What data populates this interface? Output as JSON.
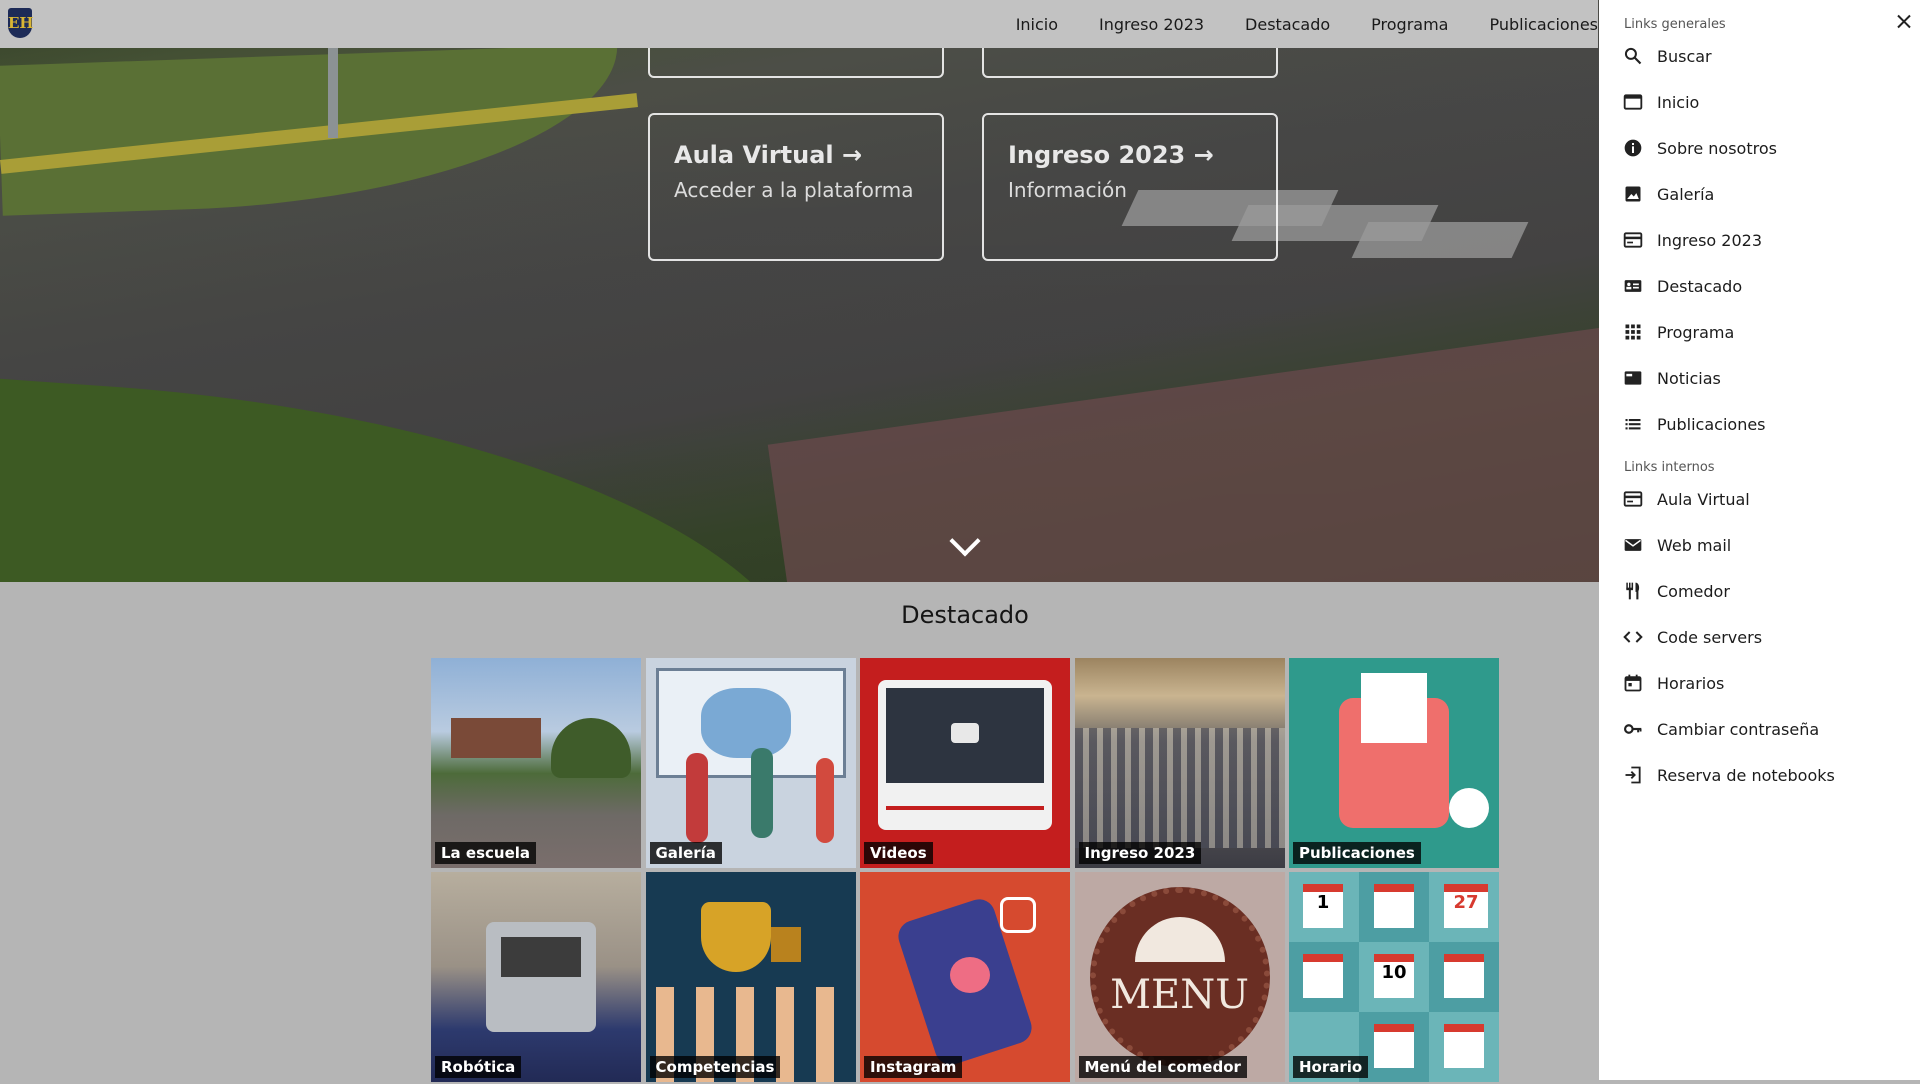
{
  "header": {
    "logo_text": "EH",
    "nav": [
      "Inicio",
      "Ingreso 2023",
      "Destacado",
      "Programa",
      "Publicaciones"
    ]
  },
  "hero": {
    "cards": [
      {
        "title": "Aula Virtual →",
        "subtitle": "Acceder a la plataforma"
      },
      {
        "title": "Ingreso 2023 →",
        "subtitle": "Información"
      }
    ]
  },
  "destacado": {
    "heading": "Destacado",
    "tiles": [
      {
        "label": "La escuela"
      },
      {
        "label": "Galería"
      },
      {
        "label": "Videos"
      },
      {
        "label": "Ingreso 2023"
      },
      {
        "label": "Publicaciones"
      },
      {
        "label": "Robótica"
      },
      {
        "label": "Competencias"
      },
      {
        "label": "Instagram"
      },
      {
        "label": "Menú del comedor"
      },
      {
        "label": "Horario"
      }
    ],
    "art_text": {
      "menu": "MENU",
      "cal_27": "27",
      "cal_1": "1",
      "cal_10": "10"
    }
  },
  "drawer": {
    "general_heading": "Links generales",
    "general": [
      {
        "label": "Buscar",
        "icon": "search-icon"
      },
      {
        "label": "Inicio",
        "icon": "window-icon"
      },
      {
        "label": "Sobre nosotros",
        "icon": "info-icon"
      },
      {
        "label": "Galería",
        "icon": "image-icon"
      },
      {
        "label": "Ingreso 2023",
        "icon": "card-icon"
      },
      {
        "label": "Destacado",
        "icon": "featured-icon"
      },
      {
        "label": "Programa",
        "icon": "grid-icon"
      },
      {
        "label": "Noticias",
        "icon": "news-icon"
      },
      {
        "label": "Publicaciones",
        "icon": "list-icon"
      }
    ],
    "internal_heading": "Links internos",
    "internal": [
      {
        "label": "Aula Virtual",
        "icon": "card-icon"
      },
      {
        "label": "Web mail",
        "icon": "mail-icon"
      },
      {
        "label": "Comedor",
        "icon": "restaurant-icon"
      },
      {
        "label": "Code servers",
        "icon": "code-icon"
      },
      {
        "label": "Horarios",
        "icon": "calendar-icon"
      },
      {
        "label": "Cambiar contraseña",
        "icon": "key-icon"
      },
      {
        "label": "Reserva de notebooks",
        "icon": "login-icon"
      }
    ]
  }
}
